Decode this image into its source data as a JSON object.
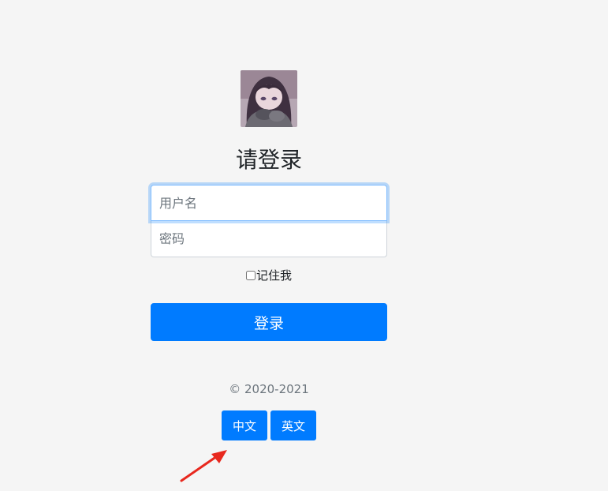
{
  "login": {
    "heading": "请登录",
    "username_placeholder": "用户名",
    "password_placeholder": "密码",
    "remember_label": "记住我",
    "submit_label": "登录"
  },
  "footer": {
    "copyright": "© 2020-2021",
    "lang_zh": "中文",
    "lang_en": "英文"
  },
  "colors": {
    "primary": "#007bff",
    "background": "#f5f5f5",
    "annotation_arrow": "#e8281e"
  }
}
